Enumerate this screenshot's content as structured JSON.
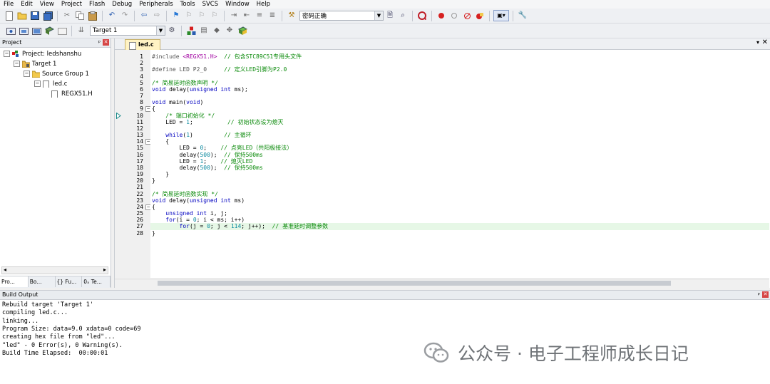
{
  "menubar": {
    "items": [
      "File",
      "Edit",
      "View",
      "Project",
      "Flash",
      "Debug",
      "Peripherals",
      "Tools",
      "SVCS",
      "Window",
      "Help"
    ]
  },
  "toolbar1": {
    "find_combo_value": "密码正确"
  },
  "toolbar2": {
    "target_combo_value": "Target 1"
  },
  "project_panel": {
    "title": "Project",
    "tree": [
      {
        "label": "Project: ledshanshu",
        "level": 0
      },
      {
        "label": "Target 1",
        "level": 1
      },
      {
        "label": "Source Group 1",
        "level": 2
      },
      {
        "label": "led.c",
        "level": 3
      },
      {
        "label": "REGX51.H",
        "level": 4
      }
    ],
    "tabs": [
      "Pro...",
      "Bo...",
      "{} Fu...",
      "0ₓ Te..."
    ]
  },
  "editor": {
    "active_tab": "led.c",
    "current_line": 10,
    "highlighted_line": 27,
    "lines": [
      {
        "n": "1",
        "segs": [
          [
            "pp",
            "#include "
          ],
          [
            "str",
            "<REGX51.H>"
          ],
          [
            "cm",
            "  // 包含STC89C51专用头文件"
          ]
        ]
      },
      {
        "n": "2",
        "segs": []
      },
      {
        "n": "3",
        "segs": [
          [
            "pp",
            "#define LED P2_0"
          ],
          [
            "cm",
            "     // 定义LED引脚为P2.0"
          ]
        ]
      },
      {
        "n": "4",
        "segs": []
      },
      {
        "n": "5",
        "segs": [
          [
            "cm",
            "/* 简易延时函数声明 */"
          ]
        ]
      },
      {
        "n": "6",
        "segs": [
          [
            "kw",
            "void"
          ],
          [
            "",
            " delay("
          ],
          [
            "kw",
            "unsigned int"
          ],
          [
            "",
            " ms);"
          ]
        ]
      },
      {
        "n": "7",
        "segs": []
      },
      {
        "n": "8",
        "segs": [
          [
            "kw",
            "void"
          ],
          [
            "",
            " main("
          ],
          [
            "kw",
            "void"
          ],
          [
            "",
            ")"
          ]
        ]
      },
      {
        "n": "9",
        "segs": [
          [
            "",
            "{"
          ]
        ]
      },
      {
        "n": "10",
        "segs": [
          [
            "",
            "    "
          ],
          [
            "cm",
            "/* 端口初始化 */"
          ]
        ]
      },
      {
        "n": "11",
        "segs": [
          [
            "",
            "    LED = "
          ],
          [
            "num",
            "1"
          ],
          [
            "",
            ";"
          ],
          [
            "cm",
            "          // 初始状态设为熄灭"
          ]
        ]
      },
      {
        "n": "12",
        "segs": []
      },
      {
        "n": "13",
        "segs": [
          [
            "",
            "    "
          ],
          [
            "kw",
            "while"
          ],
          [
            "",
            "("
          ],
          [
            "num",
            "1"
          ],
          [
            "",
            ")"
          ],
          [
            "cm",
            "         // 主循环"
          ]
        ]
      },
      {
        "n": "14",
        "segs": [
          [
            "",
            "    {"
          ]
        ]
      },
      {
        "n": "15",
        "segs": [
          [
            "",
            "        LED = "
          ],
          [
            "num",
            "0"
          ],
          [
            "",
            ";"
          ],
          [
            "cm",
            "    // 点亮LED（共阳极接法）"
          ]
        ]
      },
      {
        "n": "16",
        "segs": [
          [
            "",
            "        delay("
          ],
          [
            "num",
            "500"
          ],
          [
            "",
            ");"
          ],
          [
            "cm",
            "  // 保持500ms"
          ]
        ]
      },
      {
        "n": "17",
        "segs": [
          [
            "",
            "        LED = "
          ],
          [
            "num",
            "1"
          ],
          [
            "",
            ";"
          ],
          [
            "cm",
            "    // 熄灭LED"
          ]
        ]
      },
      {
        "n": "18",
        "segs": [
          [
            "",
            "        delay("
          ],
          [
            "num",
            "500"
          ],
          [
            "",
            ");"
          ],
          [
            "cm",
            "  // 保持500ms"
          ]
        ]
      },
      {
        "n": "19",
        "segs": [
          [
            "",
            "    }"
          ]
        ]
      },
      {
        "n": "20",
        "segs": [
          [
            "",
            "}"
          ]
        ]
      },
      {
        "n": "21",
        "segs": []
      },
      {
        "n": "22",
        "segs": [
          [
            "cm",
            "/* 简易延时函数实现 */"
          ]
        ]
      },
      {
        "n": "23",
        "segs": [
          [
            "kw",
            "void"
          ],
          [
            "",
            " delay("
          ],
          [
            "kw",
            "unsigned int"
          ],
          [
            "",
            " ms)"
          ]
        ]
      },
      {
        "n": "24",
        "segs": [
          [
            "",
            "{"
          ]
        ]
      },
      {
        "n": "25",
        "segs": [
          [
            "",
            "    "
          ],
          [
            "kw",
            "unsigned int"
          ],
          [
            "",
            " i, j;"
          ]
        ]
      },
      {
        "n": "26",
        "segs": [
          [
            "",
            "    "
          ],
          [
            "kw",
            "for"
          ],
          [
            "",
            "(i = "
          ],
          [
            "num",
            "0"
          ],
          [
            "",
            "; i < ms; i++)"
          ]
        ]
      },
      {
        "n": "27",
        "segs": [
          [
            "",
            "        "
          ],
          [
            "kw",
            "for"
          ],
          [
            "",
            "(j = "
          ],
          [
            "num",
            "0"
          ],
          [
            "",
            "; j < "
          ],
          [
            "num",
            "114"
          ],
          [
            "",
            "; j++);"
          ],
          [
            "cm",
            "  // 基准延时调整参数"
          ]
        ]
      },
      {
        "n": "28",
        "segs": [
          [
            "",
            "}"
          ]
        ]
      }
    ],
    "fold_lines": [
      9,
      14,
      24
    ]
  },
  "build_output": {
    "title": "Build Output",
    "lines": [
      "Rebuild target 'Target 1'",
      "compiling led.c...",
      "linking...",
      "Program Size: data=9.0 xdata=0 code=69",
      "creating hex file from \"led\"...",
      "\"led\" - 0 Error(s), 0 Warning(s).",
      "Build Time Elapsed:  00:00:01"
    ]
  },
  "watermark": {
    "text": "公众号 · 电子工程师成长日记"
  },
  "colors": {
    "comment": "#0a8a0a",
    "keyword": "#0000c0",
    "number": "#0a8aa0",
    "string": "#a000a0",
    "current_line_bg": "#e6f7e6",
    "tab_bg": "#fff3c4"
  }
}
